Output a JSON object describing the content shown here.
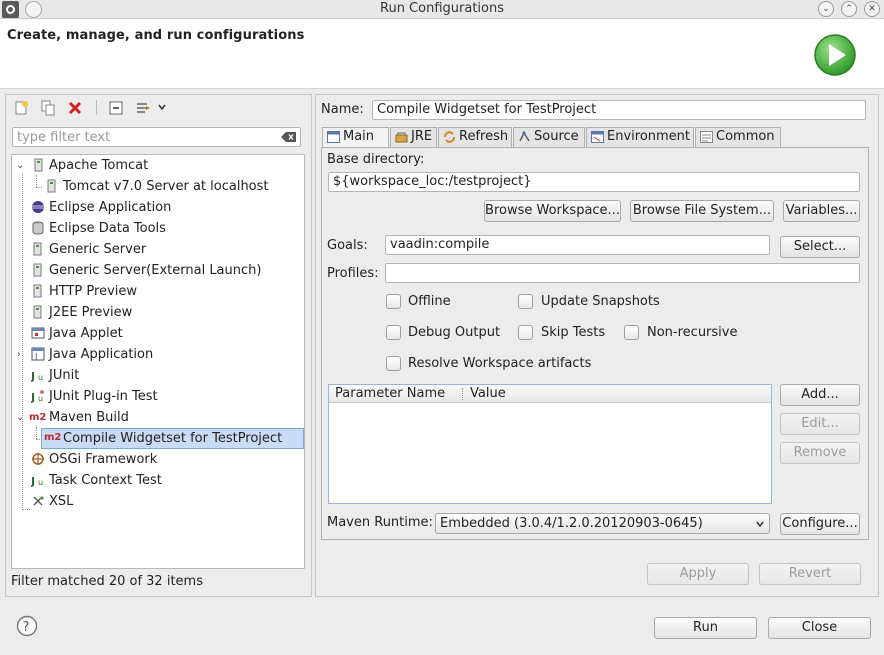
{
  "window": {
    "title": "Run Configurations",
    "controls": [
      "minimize",
      "maximize",
      "close"
    ]
  },
  "header": {
    "title": "Create, manage, and run configurations",
    "run_icon": "run-play-icon"
  },
  "left": {
    "toolbar": [
      "new-config-icon",
      "duplicate-icon",
      "delete-icon",
      "collapse-all-icon",
      "filter-icon",
      "chevron-down-icon"
    ],
    "filter_placeholder": "type filter text",
    "tree": [
      {
        "label": "Apache Tomcat",
        "icon": "server-icon",
        "level": 0,
        "expanded": true
      },
      {
        "label": "Tomcat v7.0 Server at localhost",
        "icon": "server-icon",
        "level": 1
      },
      {
        "label": "Eclipse Application",
        "icon": "eclipse-icon",
        "level": 0
      },
      {
        "label": "Eclipse Data Tools",
        "icon": "database-icon",
        "level": 0
      },
      {
        "label": "Generic Server",
        "icon": "server-icon",
        "level": 0
      },
      {
        "label": "Generic Server(External Launch)",
        "icon": "server-icon",
        "level": 0
      },
      {
        "label": "HTTP Preview",
        "icon": "server-icon",
        "level": 0
      },
      {
        "label": "J2EE Preview",
        "icon": "server-icon",
        "level": 0
      },
      {
        "label": "Java Applet",
        "icon": "applet-icon",
        "level": 0
      },
      {
        "label": "Java Application",
        "icon": "java-app-icon",
        "level": 0,
        "collapsed": true
      },
      {
        "label": "JUnit",
        "icon": "junit-icon",
        "level": 0
      },
      {
        "label": "JUnit Plug-in Test",
        "icon": "junit-plugin-icon",
        "level": 0
      },
      {
        "label": "Maven Build",
        "icon": "maven-icon",
        "level": 0,
        "expanded": true
      },
      {
        "label": "Compile Widgetset for TestProject",
        "icon": "maven-icon",
        "level": 1,
        "selected": true
      },
      {
        "label": "OSGi Framework",
        "icon": "osgi-icon",
        "level": 0
      },
      {
        "label": "Task Context Test",
        "icon": "junit-icon",
        "level": 0
      },
      {
        "label": "XSL",
        "icon": "xsl-icon",
        "level": 0
      }
    ],
    "status": "Filter matched 20 of 32 items"
  },
  "right": {
    "name_label": "Name:",
    "name_value": "Compile Widgetset for TestProject",
    "tabs": [
      {
        "label": "Main",
        "icon": "main-tab-icon",
        "active": true
      },
      {
        "label": "JRE",
        "icon": "jre-icon"
      },
      {
        "label": "Refresh",
        "icon": "refresh-icon"
      },
      {
        "label": "Source",
        "icon": "source-icon"
      },
      {
        "label": "Environment",
        "icon": "environment-icon"
      },
      {
        "label": "Common",
        "icon": "common-icon"
      }
    ],
    "base_dir_label": "Base directory:",
    "base_dir_value": "${workspace_loc:/testproject}",
    "browse_workspace": "Browse Workspace...",
    "browse_fs": "Browse File System...",
    "variables": "Variables...",
    "goals_label": "Goals:",
    "goals_value": "vaadin:compile",
    "select_btn": "Select...",
    "profiles_label": "Profiles:",
    "profiles_value": "",
    "checks": {
      "offline": "Offline",
      "update_snapshots": "Update Snapshots",
      "debug_output": "Debug Output",
      "skip_tests": "Skip Tests",
      "non_recursive": "Non-recursive",
      "resolve_workspace": "Resolve Workspace artifacts"
    },
    "table": {
      "col1": "Parameter Name",
      "col2": "Value",
      "rows": []
    },
    "add_btn": "Add...",
    "edit_btn": "Edit...",
    "remove_btn": "Remove",
    "runtime_label": "Maven Runtime:",
    "runtime_value": "Embedded (3.0.4/1.2.0.20120903-0645)",
    "configure_btn": "Configure...",
    "apply_btn": "Apply",
    "revert_btn": "Revert"
  },
  "footer": {
    "help_icon": "help-icon",
    "run_btn": "Run",
    "close_btn": "Close"
  }
}
